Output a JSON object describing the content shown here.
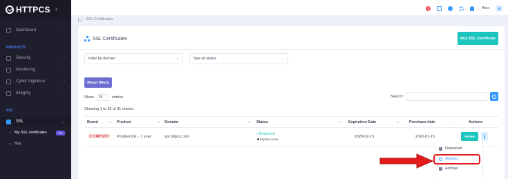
{
  "brand": {
    "name": "HTTPCS",
    "collapse_glyph": "‹"
  },
  "sidebar": {
    "items_top": [
      {
        "label": "Dashboard",
        "icon": "dashboard-icon"
      }
    ],
    "section_products": "PRODUCTS",
    "products": [
      {
        "label": "Security",
        "icon": "shield-icon"
      },
      {
        "label": "Monitoring",
        "icon": "monitor-icon"
      },
      {
        "label": "Cyber Vigilance",
        "icon": "eye-icon"
      },
      {
        "label": "Integrity",
        "icon": "integrity-icon"
      }
    ],
    "section_ssl": "SSL",
    "ssl": {
      "label": "SSL",
      "icon": "lock-icon"
    },
    "sub": [
      {
        "label": "My SSL certificates",
        "badge": "31"
      },
      {
        "label": "Buy"
      }
    ],
    "chevron": "›",
    "chevron_open": "⌄"
  },
  "topbar": {
    "notification_count": "1",
    "user": "Alex"
  },
  "breadcrumb": {
    "label": "SSL Certificates"
  },
  "page": {
    "title": "SSL Certificates",
    "buy_button": "Buy SSL Certificate",
    "filter_domain": "Filter by domain",
    "filter_status": "See all status",
    "reset_button": "Reset filters",
    "show_label": "Show",
    "show_value": "25",
    "entries_label": "entries",
    "search_label": "Search:",
    "showing_text": "Showing 1 to 25 of 31 entries",
    "caret": "⌄"
  },
  "table": {
    "headers": {
      "brand": "Brand",
      "product": "Product",
      "domain": "Domain",
      "status": "Status",
      "expiration": "Expiration Date",
      "purchase": "Purchase date",
      "actions": "Actions"
    },
    "rows": [
      {
        "brand": "COMODO",
        "product": "PositiveSSL - 1 year",
        "domain": "api.httpcs.com",
        "status": "• Delivered",
        "status_note": "Expires soon",
        "expiration": "2020-02-15",
        "purchase": "2020-01-15",
        "action": "Renew"
      }
    ]
  },
  "dropdown": {
    "items": [
      {
        "label": "Download",
        "icon": "download-icon"
      },
      {
        "label": "Options",
        "icon": "options-icon"
      },
      {
        "label": "Archive",
        "icon": "archive-icon"
      }
    ]
  },
  "colors": {
    "sidebar_bg": "#1e1e2d",
    "accent_blue": "#3699ff",
    "success": "#1bc5bd",
    "reset_purple": "#6c6fcf",
    "annotation_red": "#e31b1b"
  }
}
